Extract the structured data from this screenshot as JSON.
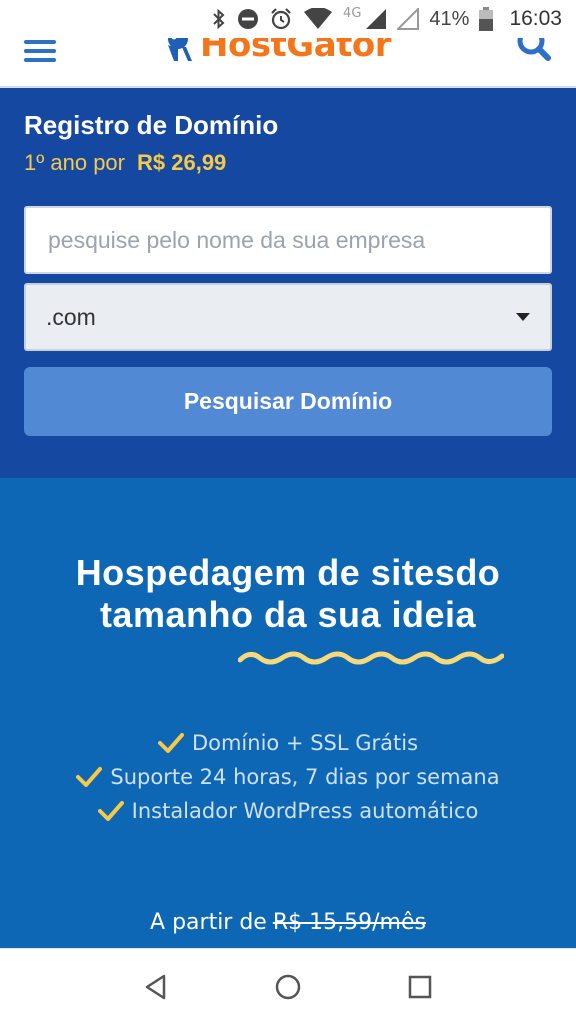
{
  "status_bar": {
    "network": "4G",
    "battery_percent": "41%",
    "time": "16:03",
    "icons": [
      "bluetooth-icon",
      "do-not-disturb-icon",
      "alarm-icon",
      "wifi-icon",
      "signal-icon",
      "battery-icon"
    ]
  },
  "header": {
    "logo_text": "HostGator",
    "icons": [
      "menu-icon",
      "gator-logo-icon",
      "search-icon"
    ],
    "accent_color": "#2d70c8",
    "logo_color": "#f5761a"
  },
  "domain": {
    "title": "Registro de Domínio",
    "price_prefix": "1º ano por",
    "price": "R$ 26,99",
    "search_placeholder": "pesquise pelo nome da sua empresa",
    "search_value": "",
    "tld_selected": ".com",
    "button_label": "Pesquisar Domínio",
    "bg_color": "#1548a0",
    "button_color": "#5289d4"
  },
  "hero": {
    "title_line1": "Hospedagem de sitesdo",
    "title_line2": "tamanho da sua ideia",
    "features": [
      "Domínio + SSL Grátis",
      "Suporte 24 horas, 7 dias por semana",
      "Instalador WordPress automático"
    ],
    "from_label": "A partir de",
    "old_price": "R$ 15,59/mês",
    "bg_color": "#0d67b5",
    "accent_color": "#f7c948"
  },
  "nav_bar": {
    "icons": [
      "back-icon",
      "home-icon",
      "recents-icon"
    ]
  }
}
